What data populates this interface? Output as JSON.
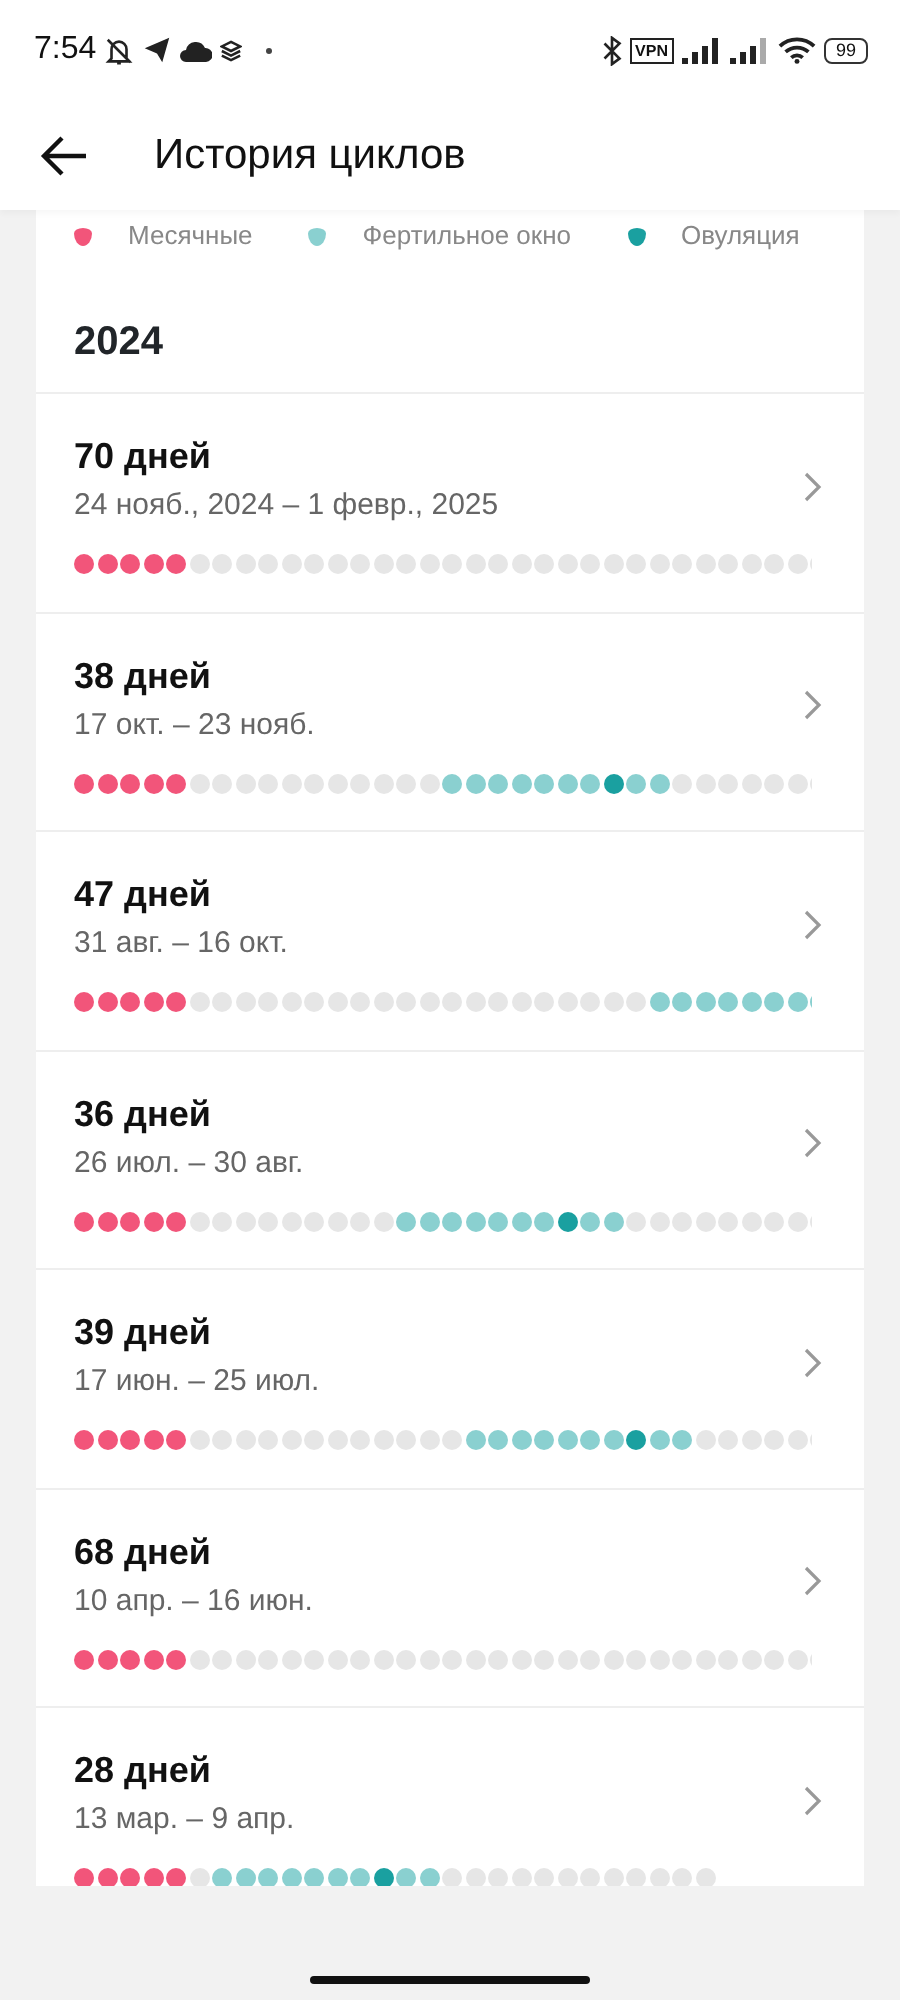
{
  "status_bar": {
    "time": "7:54",
    "vpn": "VPN",
    "battery": "99"
  },
  "header": {
    "title": "История циклов"
  },
  "legend": [
    {
      "label": "Месячные",
      "color": "#f2557a"
    },
    {
      "label": "Фертильное окно",
      "color": "#8ad0d0"
    },
    {
      "label": "Овуляция",
      "color": "#1aa0a0"
    }
  ],
  "year": "2024",
  "cycles": [
    {
      "days": "70 дней",
      "dates": "24 нояб., 2024 – 1 февр., 2025",
      "dots": [
        {
          "kind": "period"
        },
        {
          "kind": "period"
        },
        {
          "kind": "period"
        },
        {
          "kind": "period"
        },
        {
          "kind": "period"
        },
        {
          "kind": "plain"
        },
        {
          "kind": "plain"
        },
        {
          "kind": "plain"
        },
        {
          "kind": "plain"
        },
        {
          "kind": "plain"
        },
        {
          "kind": "plain"
        },
        {
          "kind": "plain"
        },
        {
          "kind": "plain"
        },
        {
          "kind": "plain"
        },
        {
          "kind": "plain"
        },
        {
          "kind": "plain"
        },
        {
          "kind": "plain"
        },
        {
          "kind": "plain"
        },
        {
          "kind": "plain"
        },
        {
          "kind": "plain"
        },
        {
          "kind": "plain"
        },
        {
          "kind": "plain"
        },
        {
          "kind": "plain"
        },
        {
          "kind": "plain"
        },
        {
          "kind": "plain"
        },
        {
          "kind": "plain"
        },
        {
          "kind": "plain"
        },
        {
          "kind": "plain"
        },
        {
          "kind": "plain"
        },
        {
          "kind": "plain"
        },
        {
          "kind": "plain"
        },
        {
          "kind": "plain"
        },
        {
          "kind": "plain"
        }
      ]
    },
    {
      "days": "38 дней",
      "dates": "17 окт. – 23 нояб.",
      "dots": [
        {
          "kind": "period"
        },
        {
          "kind": "period"
        },
        {
          "kind": "period"
        },
        {
          "kind": "period"
        },
        {
          "kind": "period"
        },
        {
          "kind": "plain"
        },
        {
          "kind": "plain"
        },
        {
          "kind": "plain"
        },
        {
          "kind": "plain"
        },
        {
          "kind": "plain"
        },
        {
          "kind": "plain"
        },
        {
          "kind": "plain"
        },
        {
          "kind": "plain"
        },
        {
          "kind": "plain"
        },
        {
          "kind": "plain"
        },
        {
          "kind": "plain"
        },
        {
          "kind": "fertile"
        },
        {
          "kind": "fertile"
        },
        {
          "kind": "fertile"
        },
        {
          "kind": "fertile"
        },
        {
          "kind": "fertile"
        },
        {
          "kind": "fertile"
        },
        {
          "kind": "fertile"
        },
        {
          "kind": "ovulation"
        },
        {
          "kind": "fertile"
        },
        {
          "kind": "fertile"
        },
        {
          "kind": "plain"
        },
        {
          "kind": "plain"
        },
        {
          "kind": "plain"
        },
        {
          "kind": "plain"
        },
        {
          "kind": "plain"
        },
        {
          "kind": "plain"
        },
        {
          "kind": "plain"
        }
      ]
    },
    {
      "days": "47 дней",
      "dates": "31 авг. – 16 окт.",
      "dots": [
        {
          "kind": "period"
        },
        {
          "kind": "period"
        },
        {
          "kind": "period"
        },
        {
          "kind": "period"
        },
        {
          "kind": "period"
        },
        {
          "kind": "plain"
        },
        {
          "kind": "plain"
        },
        {
          "kind": "plain"
        },
        {
          "kind": "plain"
        },
        {
          "kind": "plain"
        },
        {
          "kind": "plain"
        },
        {
          "kind": "plain"
        },
        {
          "kind": "plain"
        },
        {
          "kind": "plain"
        },
        {
          "kind": "plain"
        },
        {
          "kind": "plain"
        },
        {
          "kind": "plain"
        },
        {
          "kind": "plain"
        },
        {
          "kind": "plain"
        },
        {
          "kind": "plain"
        },
        {
          "kind": "plain"
        },
        {
          "kind": "plain"
        },
        {
          "kind": "plain"
        },
        {
          "kind": "plain"
        },
        {
          "kind": "plain"
        },
        {
          "kind": "fertile"
        },
        {
          "kind": "fertile"
        },
        {
          "kind": "fertile"
        },
        {
          "kind": "fertile"
        },
        {
          "kind": "fertile"
        },
        {
          "kind": "fertile"
        },
        {
          "kind": "fertile"
        },
        {
          "kind": "fertile"
        }
      ]
    },
    {
      "days": "36 дней",
      "dates": "26 июл. – 30 авг.",
      "dots": [
        {
          "kind": "period"
        },
        {
          "kind": "period"
        },
        {
          "kind": "period"
        },
        {
          "kind": "period"
        },
        {
          "kind": "period"
        },
        {
          "kind": "plain"
        },
        {
          "kind": "plain"
        },
        {
          "kind": "plain"
        },
        {
          "kind": "plain"
        },
        {
          "kind": "plain"
        },
        {
          "kind": "plain"
        },
        {
          "kind": "plain"
        },
        {
          "kind": "plain"
        },
        {
          "kind": "plain"
        },
        {
          "kind": "fertile"
        },
        {
          "kind": "fertile"
        },
        {
          "kind": "fertile"
        },
        {
          "kind": "fertile"
        },
        {
          "kind": "fertile"
        },
        {
          "kind": "fertile"
        },
        {
          "kind": "fertile"
        },
        {
          "kind": "ovulation"
        },
        {
          "kind": "fertile"
        },
        {
          "kind": "fertile"
        },
        {
          "kind": "plain"
        },
        {
          "kind": "plain"
        },
        {
          "kind": "plain"
        },
        {
          "kind": "plain"
        },
        {
          "kind": "plain"
        },
        {
          "kind": "plain"
        },
        {
          "kind": "plain"
        },
        {
          "kind": "plain"
        },
        {
          "kind": "plain"
        }
      ]
    },
    {
      "days": "39 дней",
      "dates": "17 июн. – 25 июл.",
      "dots": [
        {
          "kind": "period"
        },
        {
          "kind": "period"
        },
        {
          "kind": "period"
        },
        {
          "kind": "period"
        },
        {
          "kind": "period"
        },
        {
          "kind": "plain"
        },
        {
          "kind": "plain"
        },
        {
          "kind": "plain"
        },
        {
          "kind": "plain"
        },
        {
          "kind": "plain"
        },
        {
          "kind": "plain"
        },
        {
          "kind": "plain"
        },
        {
          "kind": "plain"
        },
        {
          "kind": "plain"
        },
        {
          "kind": "plain"
        },
        {
          "kind": "plain"
        },
        {
          "kind": "plain"
        },
        {
          "kind": "fertile"
        },
        {
          "kind": "fertile"
        },
        {
          "kind": "fertile"
        },
        {
          "kind": "fertile"
        },
        {
          "kind": "fertile"
        },
        {
          "kind": "fertile"
        },
        {
          "kind": "fertile"
        },
        {
          "kind": "ovulation"
        },
        {
          "kind": "fertile"
        },
        {
          "kind": "fertile"
        },
        {
          "kind": "plain"
        },
        {
          "kind": "plain"
        },
        {
          "kind": "plain"
        },
        {
          "kind": "plain"
        },
        {
          "kind": "plain"
        },
        {
          "kind": "plain"
        }
      ]
    },
    {
      "days": "68 дней",
      "dates": "10 апр. – 16 июн.",
      "dots": [
        {
          "kind": "period"
        },
        {
          "kind": "period"
        },
        {
          "kind": "period"
        },
        {
          "kind": "period"
        },
        {
          "kind": "period"
        },
        {
          "kind": "plain"
        },
        {
          "kind": "plain"
        },
        {
          "kind": "plain"
        },
        {
          "kind": "plain"
        },
        {
          "kind": "plain"
        },
        {
          "kind": "plain"
        },
        {
          "kind": "plain"
        },
        {
          "kind": "plain"
        },
        {
          "kind": "plain"
        },
        {
          "kind": "plain"
        },
        {
          "kind": "plain"
        },
        {
          "kind": "plain"
        },
        {
          "kind": "plain"
        },
        {
          "kind": "plain"
        },
        {
          "kind": "plain"
        },
        {
          "kind": "plain"
        },
        {
          "kind": "plain"
        },
        {
          "kind": "plain"
        },
        {
          "kind": "plain"
        },
        {
          "kind": "plain"
        },
        {
          "kind": "plain"
        },
        {
          "kind": "plain"
        },
        {
          "kind": "plain"
        },
        {
          "kind": "plain"
        },
        {
          "kind": "plain"
        },
        {
          "kind": "plain"
        },
        {
          "kind": "plain"
        },
        {
          "kind": "plain"
        }
      ]
    },
    {
      "days": "28 дней",
      "dates": "13 мар. – 9 апр.",
      "dots": [
        {
          "kind": "period"
        },
        {
          "kind": "period"
        },
        {
          "kind": "period"
        },
        {
          "kind": "period"
        },
        {
          "kind": "period"
        },
        {
          "kind": "plain"
        },
        {
          "kind": "fertile"
        },
        {
          "kind": "fertile"
        },
        {
          "kind": "fertile"
        },
        {
          "kind": "fertile"
        },
        {
          "kind": "fertile"
        },
        {
          "kind": "fertile"
        },
        {
          "kind": "fertile"
        },
        {
          "kind": "ovulation"
        },
        {
          "kind": "fertile"
        },
        {
          "kind": "fertile"
        },
        {
          "kind": "plain"
        },
        {
          "kind": "plain"
        },
        {
          "kind": "plain"
        },
        {
          "kind": "plain"
        },
        {
          "kind": "plain"
        },
        {
          "kind": "plain"
        },
        {
          "kind": "plain"
        },
        {
          "kind": "plain"
        },
        {
          "kind": "plain"
        },
        {
          "kind": "plain"
        },
        {
          "kind": "plain"
        },
        {
          "kind": "plain"
        }
      ]
    }
  ]
}
